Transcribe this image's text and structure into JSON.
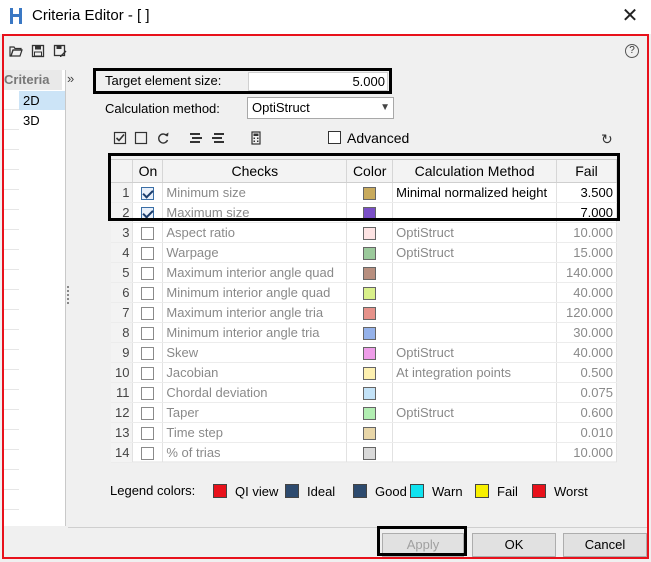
{
  "window": {
    "title": "Criteria Editor - [ ]",
    "close_glyph": "✕"
  },
  "toolbar": {
    "icons": [
      "open-folder-icon",
      "save-icon",
      "save-as-icon"
    ],
    "help_glyph": "?"
  },
  "nav": {
    "header": "Criteria",
    "items": [
      {
        "label": "2D",
        "selected": true
      },
      {
        "label": "3D",
        "selected": false
      }
    ],
    "collapse_glyph": "»"
  },
  "target": {
    "label": "Target element size:",
    "value": "5.000"
  },
  "calculation": {
    "label": "Calculation method:",
    "value": "OptiStruct"
  },
  "table_toolbar": {
    "icons": [
      "check-all-icon",
      "uncheck-all-icon",
      "refresh-icon",
      "import-icon",
      "export-icon",
      "calculator-icon"
    ],
    "advanced_label": "Advanced",
    "advanced_checked": false,
    "reset_glyph": "↻"
  },
  "table": {
    "headers": {
      "on": "On",
      "checks": "Checks",
      "color": "Color",
      "method": "Calculation Method",
      "fail": "Fail"
    },
    "rows": [
      {
        "n": "1",
        "on": true,
        "check": "Minimum size",
        "color": "#c8aa5c",
        "method": "Minimal normalized height",
        "fail": "3.500"
      },
      {
        "n": "2",
        "on": true,
        "check": "Maximum size",
        "color": "#7a4fc6",
        "method": "",
        "fail": "7.000"
      },
      {
        "n": "3",
        "on": false,
        "check": "Aspect ratio",
        "color": "#fde3e3",
        "method": "OptiStruct",
        "fail": "10.000"
      },
      {
        "n": "4",
        "on": false,
        "check": "Warpage",
        "color": "#9bc99b",
        "method": "OptiStruct",
        "fail": "15.000"
      },
      {
        "n": "5",
        "on": false,
        "check": "Maximum interior angle quad",
        "color": "#b88f7f",
        "method": "",
        "fail": "140.000"
      },
      {
        "n": "6",
        "on": false,
        "check": "Minimum interior angle quad",
        "color": "#d9f08a",
        "method": "",
        "fail": "40.000"
      },
      {
        "n": "7",
        "on": false,
        "check": "Maximum interior angle tria",
        "color": "#e6928a",
        "method": "",
        "fail": "120.000"
      },
      {
        "n": "8",
        "on": false,
        "check": "Minimum interior angle tria",
        "color": "#95b2ea",
        "method": "",
        "fail": "30.000"
      },
      {
        "n": "9",
        "on": false,
        "check": "Skew",
        "color": "#ee9de8",
        "method": "OptiStruct",
        "fail": "40.000"
      },
      {
        "n": "10",
        "on": false,
        "check": "Jacobian",
        "color": "#fdf0b0",
        "method": "At integration points",
        "fail": "0.500"
      },
      {
        "n": "11",
        "on": false,
        "check": "Chordal deviation",
        "color": "#c3e2f7",
        "method": "",
        "fail": "0.075"
      },
      {
        "n": "12",
        "on": false,
        "check": "Taper",
        "color": "#b2eeb2",
        "method": "OptiStruct",
        "fail": "0.600"
      },
      {
        "n": "13",
        "on": false,
        "check": "Time step",
        "color": "#e8d6a8",
        "method": "",
        "fail": "0.010"
      },
      {
        "n": "14",
        "on": false,
        "check": "% of trias",
        "color": "#d9d9d9",
        "method": "",
        "fail": "10.000"
      }
    ]
  },
  "legend": {
    "label": "Legend colors:",
    "items": [
      {
        "label": "QI view",
        "color": "#e8111b"
      },
      {
        "label": "Ideal",
        "color": "#2d4a6e"
      },
      {
        "label": "Good",
        "color": "#2d4a6e"
      },
      {
        "label": "Warn",
        "color": "#10e3f0"
      },
      {
        "label": "Fail",
        "color": "#f8f000"
      },
      {
        "label": "Worst",
        "color": "#e8111b"
      }
    ]
  },
  "buttons": {
    "apply": "Apply",
    "ok": "OK",
    "cancel": "Cancel"
  }
}
